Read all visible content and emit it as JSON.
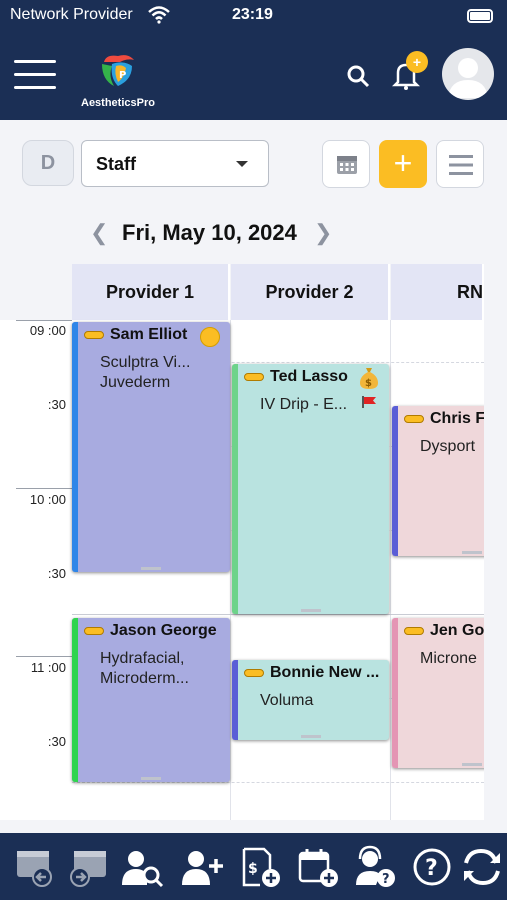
{
  "status_bar": {
    "carrier": "Network Provider",
    "time": "23:19"
  },
  "header": {
    "brand": "AestheticsPro",
    "notification_badge": "+"
  },
  "toolbar": {
    "day_button": "D",
    "filter_value": "Staff",
    "add_label": "+"
  },
  "date_nav": {
    "date": "Fri, May 10, 2024"
  },
  "columns": [
    "Provider 1",
    "Provider 2",
    "RN"
  ],
  "times": {
    "t0900": "09 :00",
    "t0930": ":30",
    "t1000": "10 :00",
    "t1030": ":30",
    "t1100": "11 :00",
    "t1130": ":30"
  },
  "appointments": [
    {
      "name": "Sam Elliot",
      "line1": "Sculptra Vi...",
      "line2": "Juvederm",
      "color": "#a8abe0",
      "bar": "#2f86e8"
    },
    {
      "name": "Ted Lasso",
      "line1": "IV Drip - E...",
      "color": "#b9e3e0",
      "bar": "#6ed38a"
    },
    {
      "name": "Chris F",
      "line1": "Dysport",
      "color": "#efd7da",
      "bar": "#5a5ed6"
    },
    {
      "name": "Jason George",
      "line1": "Hydrafacial,",
      "line2": "Microderm...",
      "color": "#a8abe0",
      "bar": "#2fd44f"
    },
    {
      "name": "Bonnie New ...",
      "line1": "Voluma",
      "color": "#b9e3e0",
      "bar": "#5a5ed6"
    },
    {
      "name": "Jen Go",
      "line1": "Microne",
      "color": "#efd7da",
      "bar": "#e495b4"
    }
  ],
  "footer_icons": [
    "previous-window-icon",
    "next-window-icon",
    "search-client-icon",
    "add-client-icon",
    "add-sale-icon",
    "add-appointment-icon",
    "support-icon",
    "help-icon",
    "refresh-icon"
  ]
}
